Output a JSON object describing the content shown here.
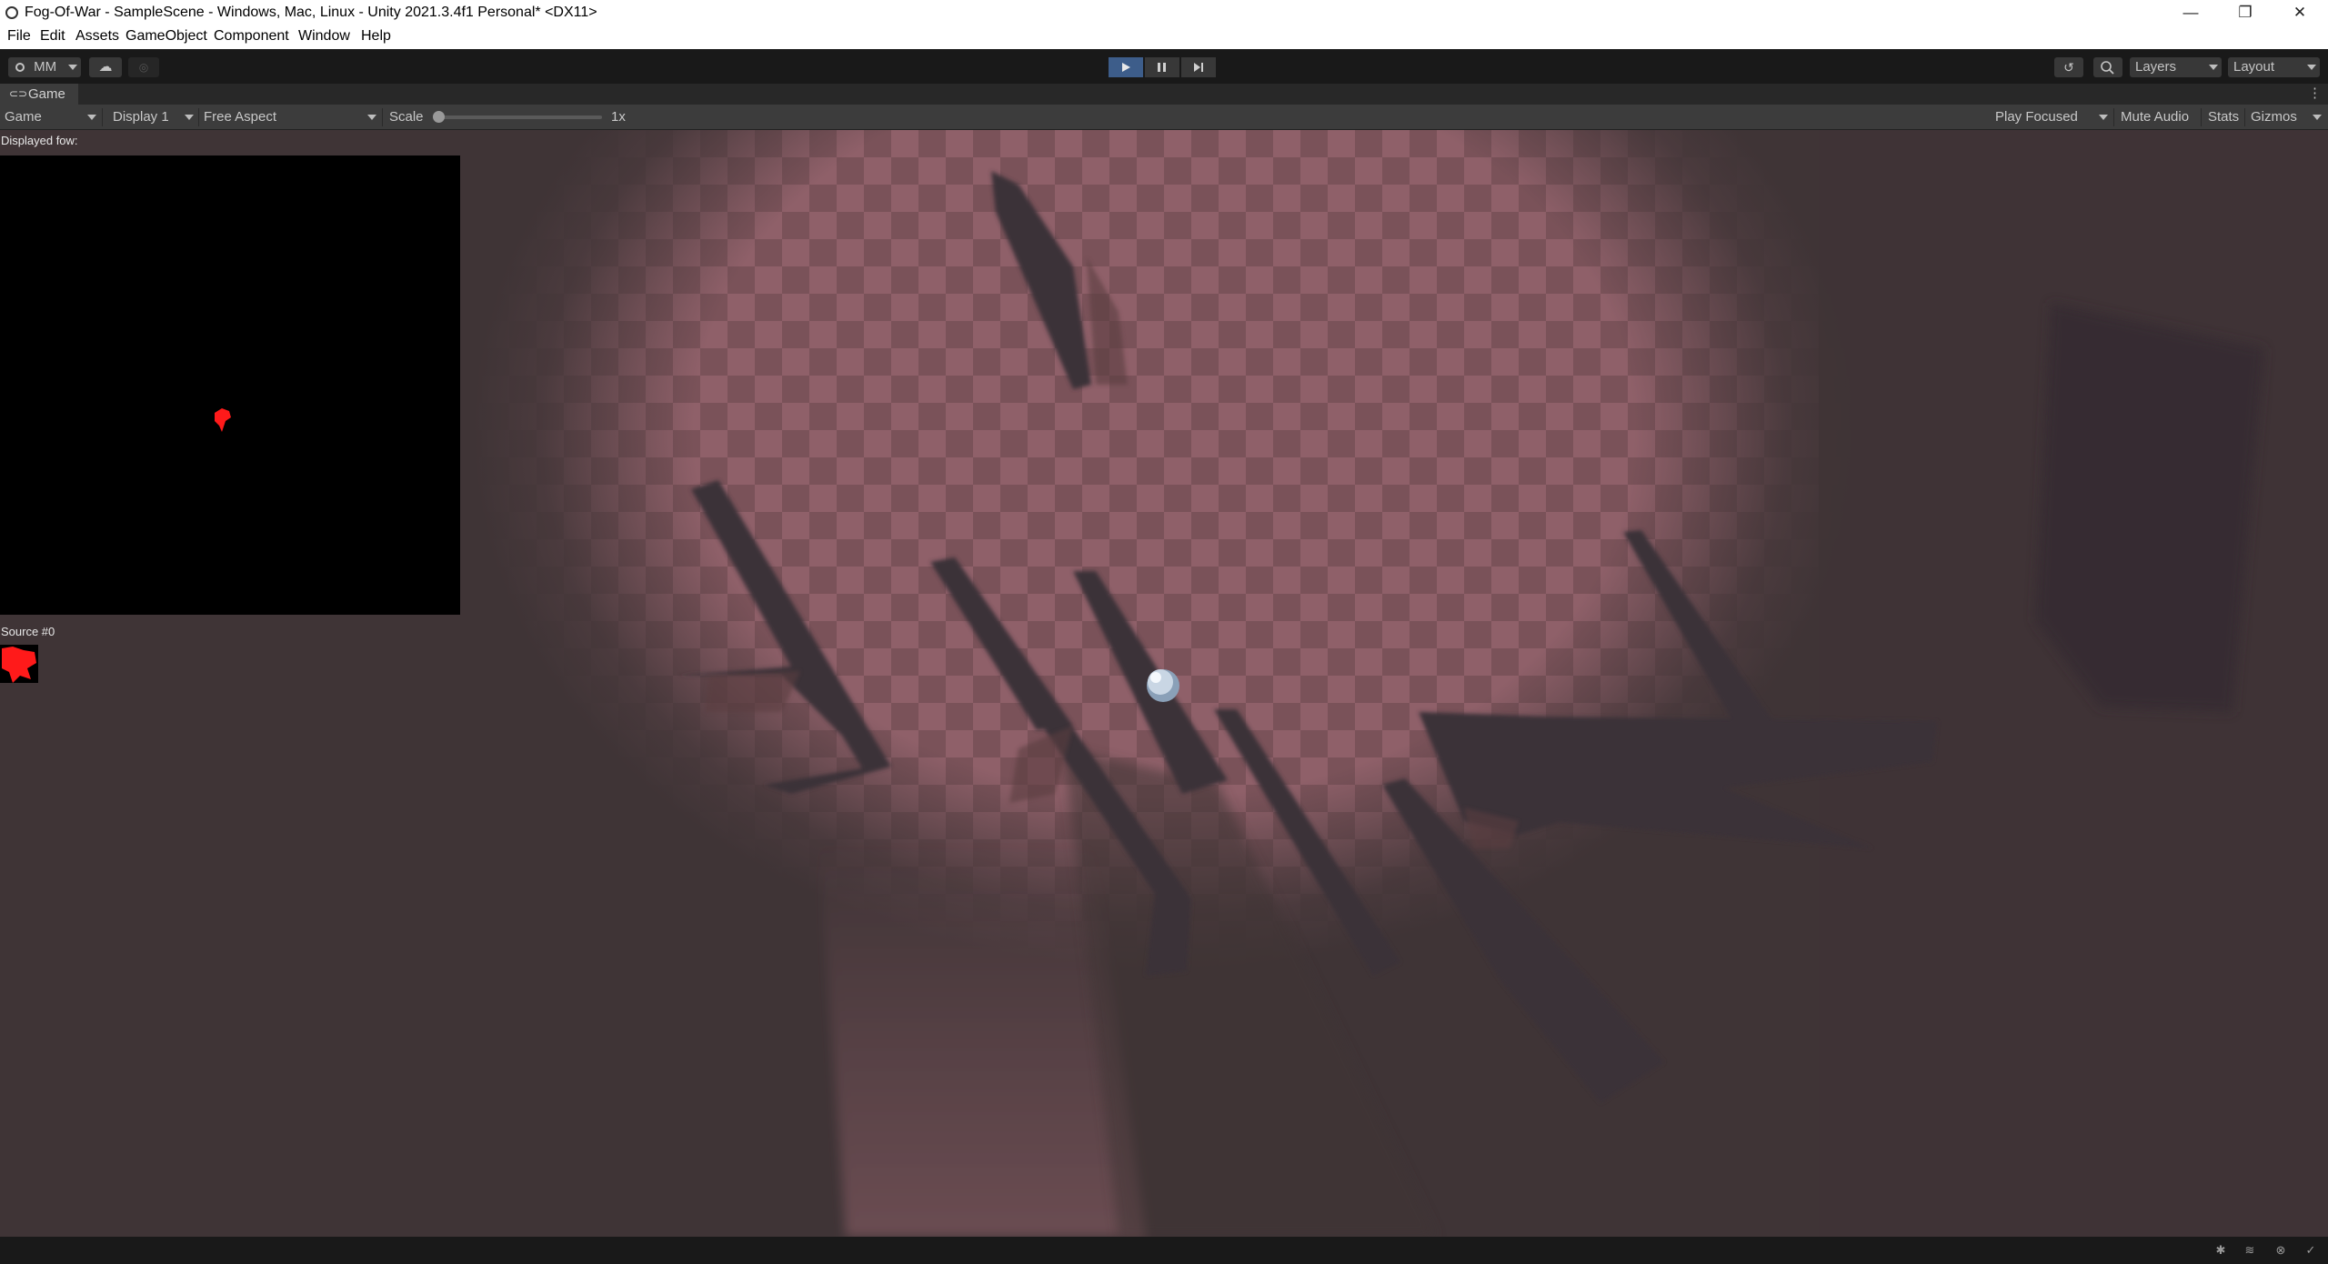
{
  "window": {
    "title": "Fog-Of-War - SampleScene - Windows, Mac, Linux - Unity 2021.3.4f1 Personal* <DX11>",
    "minimize_glyph": "—",
    "restore_glyph": "❐",
    "close_glyph": "✕"
  },
  "menu": {
    "items": [
      "File",
      "Edit",
      "Assets",
      "GameObject",
      "Component",
      "Window",
      "Help"
    ]
  },
  "toolbar": {
    "account_label": "MM",
    "layers_label": "Layers",
    "layout_label": "Layout",
    "play_state": "playing"
  },
  "tab": {
    "label": "Game"
  },
  "game_toolbar": {
    "mode": "Game",
    "display": "Display 1",
    "aspect": "Free Aspect",
    "scale_label": "Scale",
    "scale_value": "1x",
    "scale_fraction": 0.0,
    "play_focus": "Play Focused",
    "mute_audio": "Mute Audio",
    "stats": "Stats",
    "gizmos": "Gizmos"
  },
  "debug_overlay": {
    "displayed_fow_label": "Displayed fow:",
    "source_label": "Source #0"
  },
  "colors": {
    "editor_dark": "#191919",
    "panel": "#3c3c3c",
    "play_active": "#3d5d8a",
    "checker_light": "#8f6069",
    "checker_dark": "#7a5259",
    "fog": "#3f3436",
    "shadow": "#3a2f37",
    "reveal_marker": "#ff1a1a"
  },
  "icons": {
    "status": [
      "bug-icon",
      "layers-icon",
      "network-icon",
      "check-icon"
    ]
  }
}
